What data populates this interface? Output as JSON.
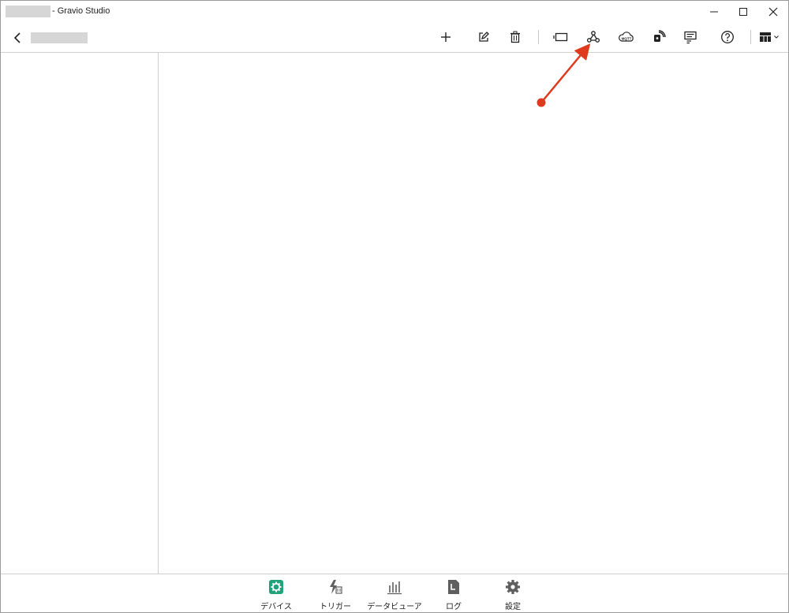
{
  "window": {
    "title": "- Gravio Studio"
  },
  "toolbar": {
    "icons": [
      "add-icon",
      "edit-icon",
      "delete-icon",
      "device-card-icon",
      "webhook-icon",
      "mqtt-cloud-icon",
      "nfc-icon",
      "message-icon",
      "help-icon",
      "layout-icon"
    ],
    "mqtt_text": "MQTT"
  },
  "bottom_nav": {
    "items": [
      {
        "label": "デバイス",
        "icon": "device-icon",
        "active": true
      },
      {
        "label": "トリガー",
        "icon": "trigger-icon",
        "active": false
      },
      {
        "label": "データビューア",
        "icon": "chart-icon",
        "active": false
      },
      {
        "label": "ログ",
        "icon": "log-icon",
        "active": false
      },
      {
        "label": "設定",
        "icon": "gear-icon",
        "active": false
      }
    ]
  },
  "colors": {
    "active": "#1fa37a",
    "inactive": "#5f5f5f",
    "annotation": "#e03a1e"
  }
}
